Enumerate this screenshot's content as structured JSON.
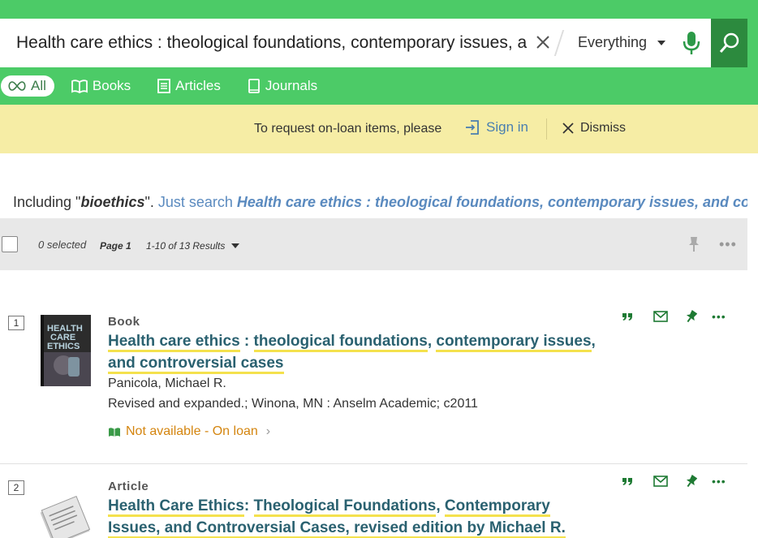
{
  "search": {
    "query": "Health care ethics : theological foundations, contemporary issues, and controversial cases",
    "scope": "Everything"
  },
  "tabs": [
    {
      "label": "All"
    },
    {
      "label": "Books"
    },
    {
      "label": "Articles"
    },
    {
      "label": "Journals"
    }
  ],
  "notice": {
    "text": "To request on-loan items, please",
    "signin_label": "Sign in",
    "dismiss_label": "Dismiss"
  },
  "including": {
    "prefix": "Including \"",
    "term": "bioethics",
    "suffix": "\".",
    "just_search": " Just search ",
    "query_link": "Health care ethics : theological foundations, contemporary issues, and controversial cases"
  },
  "results_bar": {
    "selected": "0 selected",
    "page": "Page 1",
    "range": "1-10 of 13 Results"
  },
  "results": [
    {
      "number": "1",
      "type": "Book",
      "title_parts": [
        {
          "text": "Health care ethics",
          "hl": true
        },
        {
          "text": " : ",
          "hl": false
        },
        {
          "text": "theological foundations",
          "hl": true
        },
        {
          "text": ", ",
          "hl": false
        },
        {
          "text": "contemporary issues",
          "hl": true
        },
        {
          "text": ", ",
          "hl": false
        },
        {
          "text": "and controversial cases",
          "hl": true
        }
      ],
      "author": "Panicola, Michael R.",
      "publication": "Revised and expanded.; Winona, MN : Anselm Academic; c2011",
      "availability": "Not available - On loan",
      "cover_text": [
        "HEALTH",
        "CARE",
        "ETHICS"
      ]
    },
    {
      "number": "2",
      "type": "Article",
      "title_parts": [
        {
          "text": "Health Care Ethics",
          "hl": true
        },
        {
          "text": ": ",
          "hl": false
        },
        {
          "text": "Theological Foundations",
          "hl": true
        },
        {
          "text": ", ",
          "hl": false
        },
        {
          "text": "Contemporary Issues, and Controversial Cases",
          "hl": true
        },
        {
          "text": ", revised edition by Michael R.",
          "hl": true
        }
      ]
    }
  ],
  "colors": {
    "brand_green": "#4ccb67",
    "search_button": "#2c8a3e",
    "notice_bg": "#f6eda5",
    "title_color": "#2a6170",
    "highlight": "#f4e14d",
    "availability": "#d4850f",
    "link": "#5a8abf"
  },
  "icons": {
    "clear": "close-icon",
    "mic": "microphone-icon",
    "search": "magnifier-icon",
    "all_tab": "infinity-icon",
    "books_tab": "open-book-icon",
    "articles_tab": "article-icon",
    "journals_tab": "journal-icon",
    "signin": "sign-in-icon",
    "dismiss": "close-icon",
    "pin": "pushpin-icon",
    "more": "ellipsis-icon",
    "cite": "quote-icon",
    "email": "envelope-icon",
    "availability": "open-book-icon"
  }
}
